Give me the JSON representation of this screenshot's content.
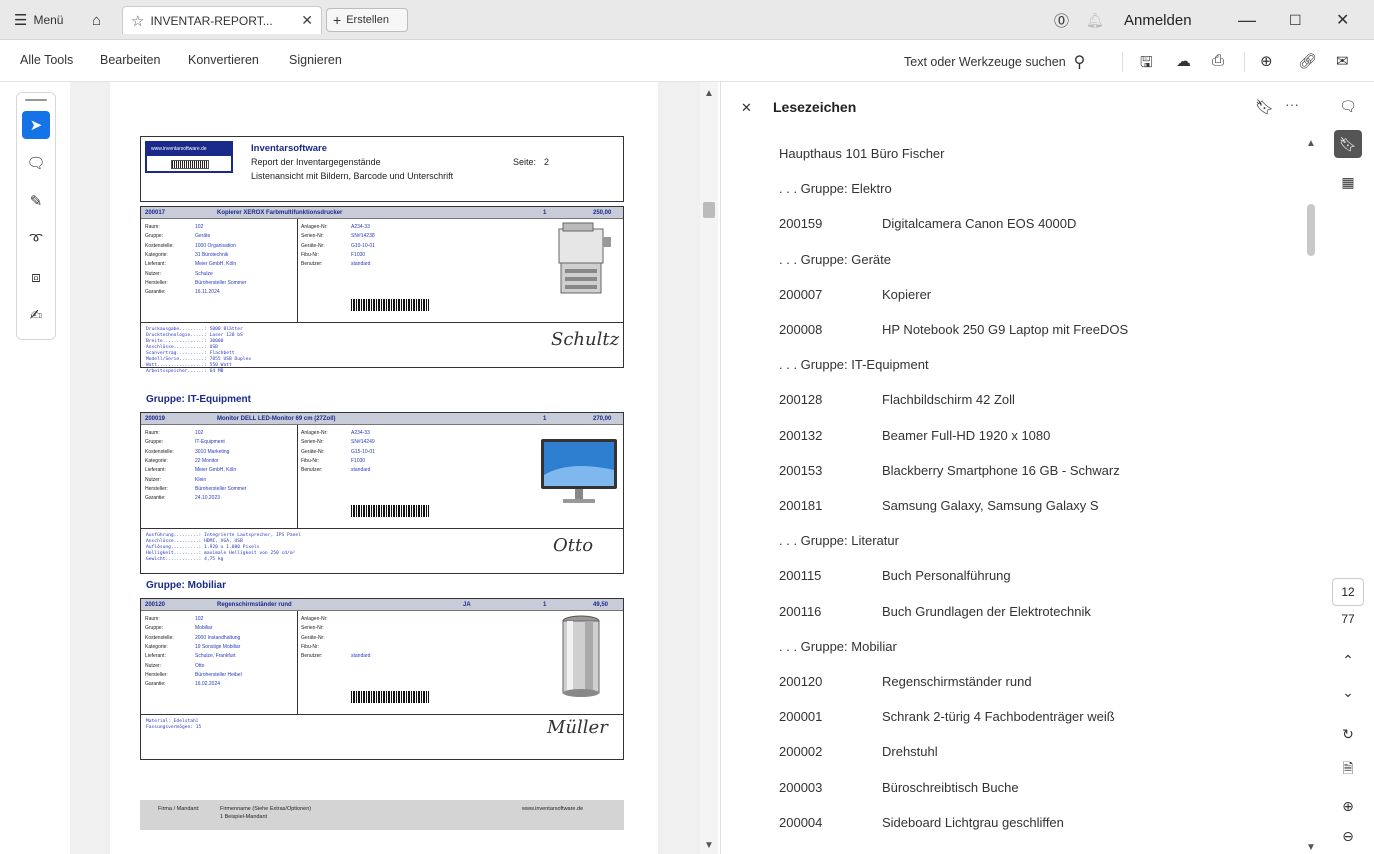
{
  "titlebar": {
    "menu_label": "Menü",
    "tab_title": "INVENTAR-REPORT...",
    "create_label": "Erstellen",
    "login_label": "Anmelden"
  },
  "menubar": {
    "items": [
      "Alle Tools",
      "Bearbeiten",
      "Konvertieren",
      "Signieren"
    ],
    "search_label": "Text oder Werkzeuge suchen"
  },
  "report": {
    "logo_text": "www.inventarsoftware.de",
    "title": "Inventarsoftware",
    "subtitle1": "Report der Inventargegenstände",
    "subtitle2": "Listenansicht mit Bildern, Barcode und Unterschrift",
    "page_label": "Seite:",
    "page_num": "2",
    "groups": [
      "Gruppe: IT-Equipment",
      "Gruppe: Mobiliar"
    ],
    "items": [
      {
        "id": "200017",
        "name": "Kopierer XEROX Farbmultifunktionsdrucker",
        "qty": "1",
        "price": "250,00",
        "ja": "",
        "left": [
          [
            "Raum:",
            "102"
          ],
          [
            "Gruppe:",
            "Geräte"
          ],
          [
            "Kostenstelle:",
            "1000 Organisation"
          ],
          [
            "Kategorie:",
            "31 Bürotechnik"
          ],
          [
            "Lieferant:",
            "Meier GmbH, Köln"
          ],
          [
            "Nutzer:",
            "Schulze"
          ],
          [
            "Hersteller:",
            "Bürohersteller Sommer"
          ],
          [
            "Garantie:",
            "16.11.2024"
          ]
        ],
        "right": [
          [
            "Anlagen-Nr:",
            "A234-33"
          ],
          [
            "Serien-Nr:",
            "SN#14238"
          ],
          [
            "Geräte-Nr:",
            "G10-10-01"
          ],
          [
            "Fibu-Nr:",
            "F1030"
          ],
          [
            "Benutzer:",
            "standard"
          ]
        ],
        "notes": "Druckausgabe.........: 5000 Blätter\nDrucktechnologie.....: Laser 128 bS\nBreite...............: 30000\nAnschlüsse...........: USB\nScanvertrag..........: Flachbett\nModell/Serie.........: 7855 USB Duplex\nWatt.................: 550 Watt\nArbeitsspeicher......: 64 MB",
        "signature": "Schultz"
      },
      {
        "id": "200019",
        "name": "Monitor DELL LED-Monitor 69 cm (27Zoll)",
        "qty": "1",
        "price": "270,00",
        "ja": "",
        "left": [
          [
            "Raum:",
            "102"
          ],
          [
            "Gruppe:",
            "IT-Equipment"
          ],
          [
            "Kostenstelle:",
            "3010 Marketing"
          ],
          [
            "Kategorie:",
            "22 Monitor"
          ],
          [
            "Lieferant:",
            "Meier GmbH, Köln"
          ],
          [
            "Nutzer:",
            "Klein"
          ],
          [
            "Hersteller:",
            "Bürohersteller Sommer"
          ],
          [
            "Garantie:",
            "24.10.2023"
          ]
        ],
        "right": [
          [
            "Anlagen-Nr:",
            "A234-33"
          ],
          [
            "Serien-Nr:",
            "SN#14249"
          ],
          [
            "Geräte-Nr:",
            "G15-10-01"
          ],
          [
            "Fibu-Nr:",
            "F1030"
          ],
          [
            "Benutzer:",
            "standard"
          ]
        ],
        "notes": "Ausführung.........: Integrierte Lautsprecher, IPS Panel\nAnschlüsse.........: HDMI, VGA, USB\nAuflösung..........: 1.920 x 1.080 Pixels\nHelligkeit.........: maximale Helligkeit von 250 cd/m²\nGewicht............: 4,75 kg",
        "signature": "Otto"
      },
      {
        "id": "200120",
        "name": "Regenschirmständer rund",
        "qty": "1",
        "price": "49,50",
        "ja": "JA",
        "left": [
          [
            "Raum:",
            "102"
          ],
          [
            "Gruppe:",
            "Mobiliar"
          ],
          [
            "Kostenstelle:",
            "2000 Instandhaltung"
          ],
          [
            "Kategorie:",
            "19 Sonstige Mobiliar"
          ],
          [
            "Lieferant:",
            "Schulze, Frankfurt"
          ],
          [
            "Nutzer:",
            "Otto"
          ],
          [
            "Hersteller:",
            "Bürohersteller Heibel"
          ],
          [
            "Garantie:",
            "16.02.2024"
          ]
        ],
        "right": [
          [
            "Anlagen-Nr:",
            ""
          ],
          [
            "Serien-Nr:",
            ""
          ],
          [
            "Geräte-Nr:",
            ""
          ],
          [
            "Fibu-Nr:",
            ""
          ],
          [
            "Benutzer:",
            "standard"
          ]
        ],
        "notes": "Material: Edelstahl\nFassungsvermögen: 15",
        "signature": "Müller"
      }
    ],
    "footer": {
      "label": "Firma / Mandant:",
      "line1": "Firmenname (Siehe Extras/Optionen)",
      "line2": "1 Beispiel-Mandant",
      "website": "www.inventarsoftware.de"
    }
  },
  "bookmarks": {
    "title": "Lesezeichen",
    "rows": [
      {
        "id": "Haupthaus 101 Büro Fischer",
        "label": ""
      },
      {
        "id": ". . . Gruppe: Elektro",
        "label": ""
      },
      {
        "id": "200159",
        "label": "Digitalcamera Canon EOS 4000D"
      },
      {
        "id": ". . . Gruppe: Geräte",
        "label": ""
      },
      {
        "id": "200007",
        "label": "Kopierer"
      },
      {
        "id": "200008",
        "label": "HP Notebook 250 G9 Laptop mit FreeDOS"
      },
      {
        "id": ". . . Gruppe: IT-Equipment",
        "label": ""
      },
      {
        "id": "200128",
        "label": "Flachbildschirm 42 Zoll"
      },
      {
        "id": "200132",
        "label": "Beamer Full-HD 1920 x 1080"
      },
      {
        "id": "200153",
        "label": "Blackberry Smartphone 16 GB - Schwarz"
      },
      {
        "id": "200181",
        "label": "Samsung Galaxy, Samsung Galaxy S"
      },
      {
        "id": ". . . Gruppe: Literatur",
        "label": ""
      },
      {
        "id": "200115",
        "label": "Buch Personalführung"
      },
      {
        "id": "200116",
        "label": "Buch Grundlagen der Elektrotechnik"
      },
      {
        "id": ". . . Gruppe: Mobiliar",
        "label": ""
      },
      {
        "id": "200120",
        "label": "Regenschirmständer rund"
      },
      {
        "id": "200001",
        "label": "Schrank 2-türig 4 Fachbodenträger weiß"
      },
      {
        "id": "200002",
        "label": "Drehstuhl"
      },
      {
        "id": "200003",
        "label": "Büroschreibtisch  Buche"
      },
      {
        "id": "200004",
        "label": "Sideboard Lichtgrau geschliffen"
      }
    ]
  },
  "pagination": {
    "current": "12",
    "total": "77"
  }
}
